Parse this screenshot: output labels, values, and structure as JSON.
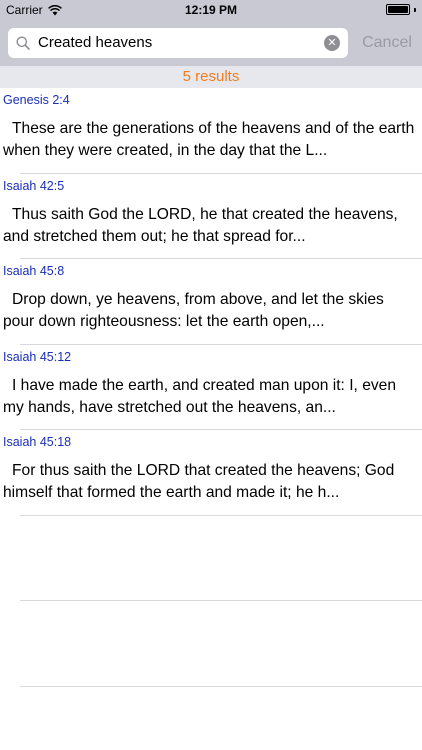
{
  "status_bar": {
    "carrier": "Carrier",
    "time": "12:19 PM"
  },
  "search": {
    "query": "Created heavens",
    "cancel_label": "Cancel"
  },
  "results_header": "5 results",
  "results": [
    {
      "ref": "Genesis 2:4",
      "text": "These are the generations of the heavens and of the earth when they were created, in the day that the L..."
    },
    {
      "ref": "Isaiah 42:5",
      "text": "Thus saith God the LORD, he that created the heavens, and stretched them out; he that spread for..."
    },
    {
      "ref": "Isaiah 45:8",
      "text": "Drop down, ye heavens, from above, and let the skies pour down righteousness: let the earth open,..."
    },
    {
      "ref": "Isaiah 45:12",
      "text": "I have made the earth, and created man upon it: I, even my hands, have stretched out the heavens, an..."
    },
    {
      "ref": "Isaiah 45:18",
      "text": "For thus saith the LORD that created the heavens; God himself that formed the earth and made it; he h..."
    }
  ],
  "colors": {
    "accent": "#f07e20",
    "reference": "#1a2fb5",
    "bar_background": "#c9c9d4"
  },
  "icons": [
    "wifi-icon",
    "battery-icon",
    "search-icon",
    "clear-icon"
  ]
}
